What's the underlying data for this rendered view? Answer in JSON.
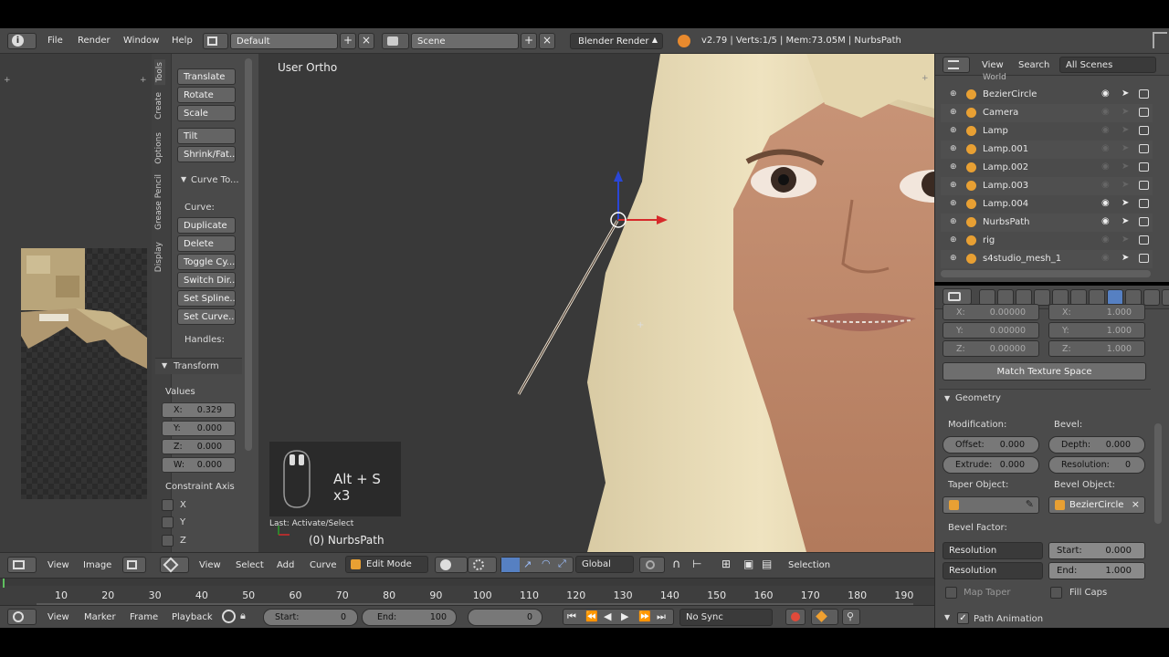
{
  "topbar": {
    "menus": [
      "File",
      "Render",
      "Window",
      "Help"
    ],
    "layout": "Default",
    "scene": "Scene",
    "engine": "Blender Render",
    "stats": "v2.79 | Verts:1/5 | Mem:73.05M | NurbsPath"
  },
  "shelf": {
    "tabs": [
      "Tools",
      "Create",
      "Options",
      "Grease Pencil",
      "Display"
    ],
    "transform_buttons": [
      "Translate",
      "Rotate",
      "Scale",
      "Tilt",
      "Shrink/Fat..."
    ],
    "curve_tools_title": "Curve To...",
    "curve_label": "Curve:",
    "curve_buttons": [
      "Duplicate",
      "Delete",
      "Toggle Cy...",
      "Switch Dir...",
      "Set Spline...",
      "Set Curve..."
    ],
    "handles_label": "Handles:",
    "transform_title": "Transform",
    "values_label": "Values",
    "fields": [
      {
        "k": "X:",
        "v": "0.329"
      },
      {
        "k": "Y:",
        "v": "0.000"
      },
      {
        "k": "Z:",
        "v": "0.000"
      },
      {
        "k": "W:",
        "v": "0.000"
      }
    ],
    "constraint_label": "Constraint Axis",
    "axes": [
      "X",
      "Y",
      "Z"
    ]
  },
  "viewport": {
    "view_name": "User Ortho",
    "shortcut": "Alt + S x3",
    "last_op": "Last: Activate/Select",
    "object_label": "(0) NurbsPath"
  },
  "outliner": {
    "view": "View",
    "search": "Search",
    "filter": "All Scenes",
    "world": "World",
    "items": [
      "BezierCircle",
      "Camera",
      "Lamp",
      "Lamp.001",
      "Lamp.002",
      "Lamp.003",
      "Lamp.004",
      "NurbsPath",
      "rig",
      "s4studio_mesh_1"
    ]
  },
  "properties": {
    "vec_a": [
      {
        "k": "X:",
        "v": "0.00000"
      },
      {
        "k": "Y:",
        "v": "0.00000"
      },
      {
        "k": "Z:",
        "v": "0.00000"
      }
    ],
    "vec_b": [
      {
        "k": "X:",
        "v": "1.000"
      },
      {
        "k": "Y:",
        "v": "1.000"
      },
      {
        "k": "Z:",
        "v": "1.000"
      }
    ],
    "match_texture": "Match Texture Space",
    "geometry_title": "Geometry",
    "modification": "Modification:",
    "bevel": "Bevel:",
    "offset": {
      "k": "Offset:",
      "v": "0.000"
    },
    "extrude": {
      "k": "Extrude:",
      "v": "0.000"
    },
    "depth": {
      "k": "Depth:",
      "v": "0.000"
    },
    "resolution": {
      "k": "Resolution:",
      "v": "0"
    },
    "taper_object": "Taper Object:",
    "bevel_object": "Bevel Object:",
    "bevel_object_value": "BezierCircle",
    "bevel_factor": "Bevel Factor:",
    "res1": "Resolution",
    "res2": "Resolution",
    "start": {
      "k": "Start:",
      "v": "0.000"
    },
    "end": {
      "k": "End:",
      "v": "1.000"
    },
    "map_taper": "Map Taper",
    "fill_caps": "Fill Caps",
    "path_animation": "Path Animation"
  },
  "image_header": {
    "view": "View",
    "image": "Image"
  },
  "view3d_header": {
    "menus": [
      "View",
      "Select",
      "Add",
      "Curve"
    ],
    "mode": "Edit Mode",
    "orientation": "Global",
    "selection": "Selection"
  },
  "timeline": {
    "ticks": [
      "10",
      "20",
      "30",
      "40",
      "50",
      "60",
      "70",
      "80",
      "90",
      "100",
      "110",
      "120",
      "130",
      "140",
      "150",
      "160",
      "170",
      "180",
      "190"
    ],
    "menus": [
      "View",
      "Marker",
      "Frame",
      "Playback"
    ],
    "start": {
      "k": "Start:",
      "v": "0"
    },
    "end": {
      "k": "End:",
      "v": "100"
    },
    "current": "0",
    "sync": "No Sync"
  }
}
